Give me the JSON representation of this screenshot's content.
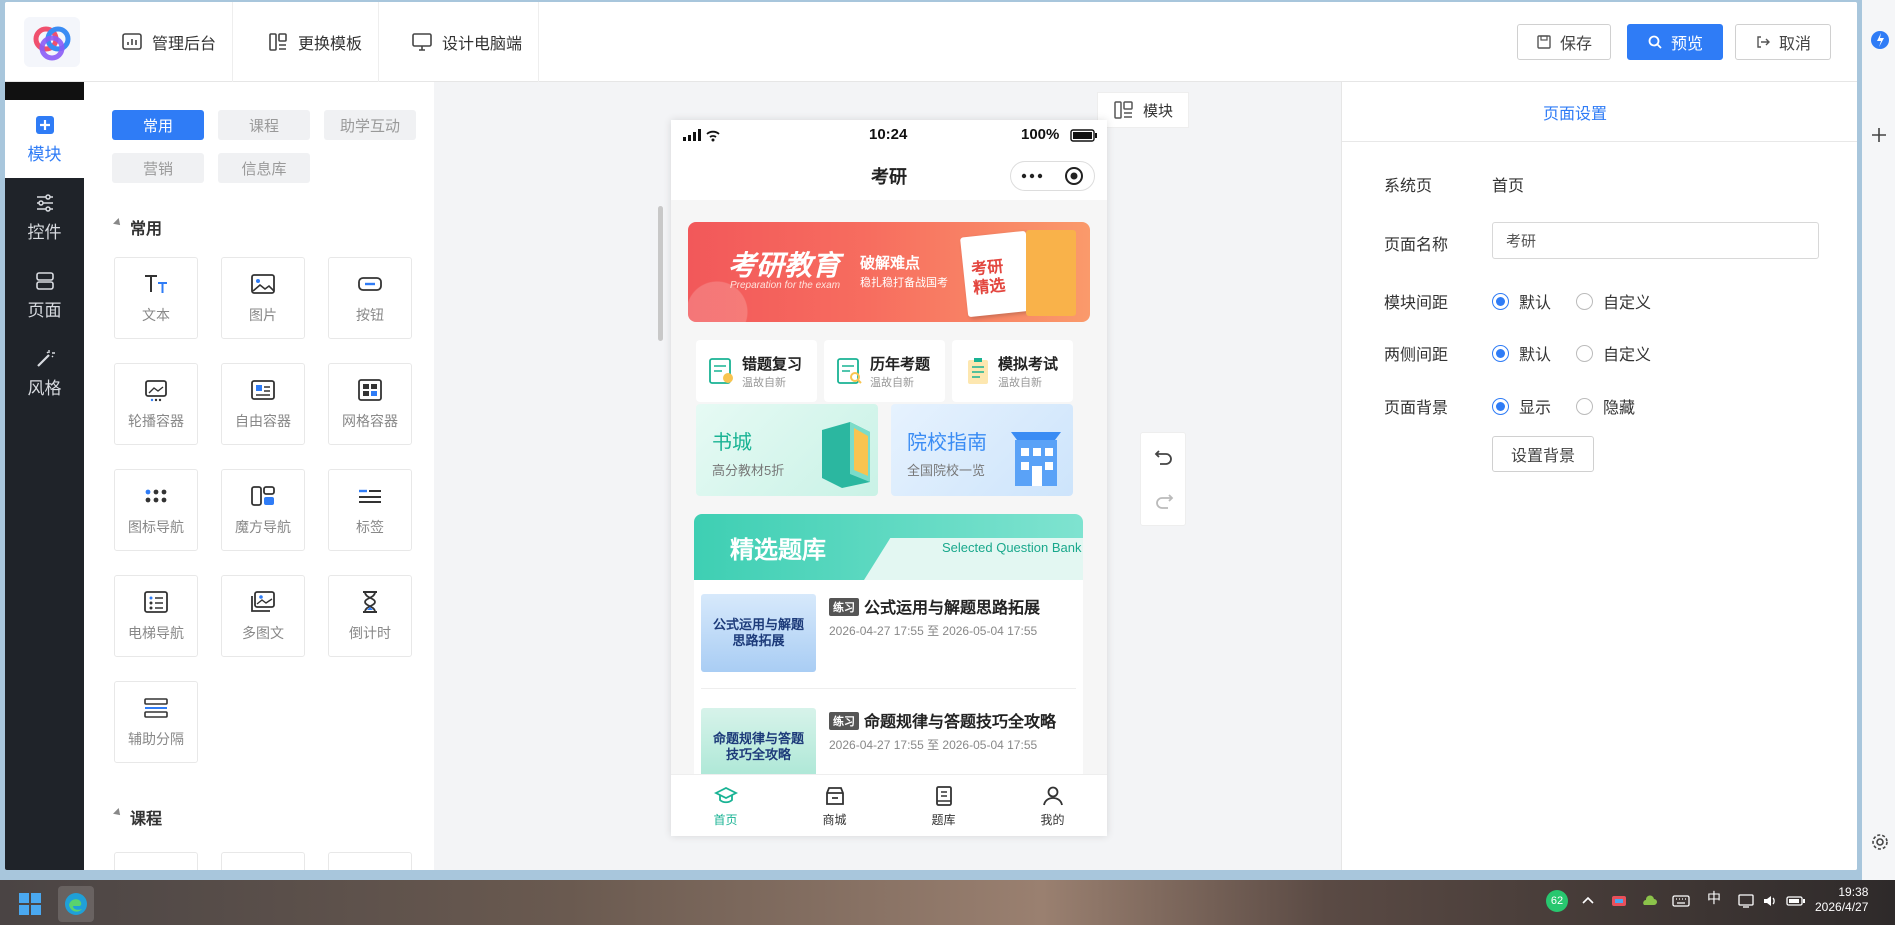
{
  "topbar": {
    "nav": [
      "管理后台",
      "更换模板",
      "设计电脑端"
    ],
    "save_label": "保存",
    "preview_label": "预览",
    "cancel_label": "取消"
  },
  "leftbar": {
    "items": [
      "模块",
      "控件",
      "页面",
      "风格"
    ],
    "active": "模块"
  },
  "palette": {
    "tabs": [
      "常用",
      "课程",
      "助学互动",
      "营销",
      "信息库"
    ],
    "active_tab": "常用",
    "section1": "常用",
    "section2": "课程",
    "components": [
      "文本",
      "图片",
      "按钮",
      "轮播容器",
      "自由容器",
      "网格容器",
      "图标导航",
      "魔方导航",
      "标签",
      "电梯导航",
      "多图文",
      "倒计时",
      "辅助分隔"
    ]
  },
  "canvas": {
    "module_btn": "模块"
  },
  "phone": {
    "time": "10:24",
    "battery": "100%",
    "title": "考研",
    "banner": {
      "main": "考研教育",
      "sub_en": "Preparation for the exam",
      "slogan1": "破解难点",
      "slogan2": "稳扎稳打备战国考",
      "book": "考研精选"
    },
    "quick": [
      {
        "title": "错题复习",
        "sub": "温故自新"
      },
      {
        "title": "历年考题",
        "sub": "温故自新"
      },
      {
        "title": "模拟考试",
        "sub": "温故自新"
      }
    ],
    "cards": [
      {
        "title": "书城",
        "sub": "高分教材5折"
      },
      {
        "title": "院校指南",
        "sub": "全国院校一览"
      }
    ],
    "qbank": {
      "title": "精选题库",
      "title_en": "Selected Question Bank",
      "items": [
        {
          "tag": "练习",
          "title": "公式运用与解题思路拓展",
          "date": "2026-04-27 17:55 至 2026-05-04 17:55",
          "thumb1": "公式运用与解题",
          "thumb2": "思路拓展"
        },
        {
          "tag": "练习",
          "title": "命题规律与答题技巧全攻略",
          "date": "2026-04-27 17:55 至 2026-05-04 17:55",
          "thumb1": "命题规律与答题",
          "thumb2": "技巧全攻略"
        }
      ]
    },
    "tabs": [
      "首页",
      "商城",
      "题库",
      "我的"
    ],
    "active_tab": "首页"
  },
  "settings": {
    "title": "页面设置",
    "sys_label": "系统页",
    "sys_value": "首页",
    "name_label": "页面名称",
    "name_value": "考研",
    "module_gap_label": "模块间距",
    "side_gap_label": "两侧间距",
    "bg_label": "页面背景",
    "opt_default": "默认",
    "opt_custom": "自定义",
    "opt_show": "显示",
    "opt_hide": "隐藏",
    "set_bg_btn": "设置背景"
  },
  "taskbar": {
    "badge": "62",
    "ime": "中",
    "time": "19:38",
    "date": "2026/4/27"
  },
  "colors": {
    "accent": "#2f7cf6",
    "teal": "#19b394",
    "sidebar": "#1f2329"
  }
}
